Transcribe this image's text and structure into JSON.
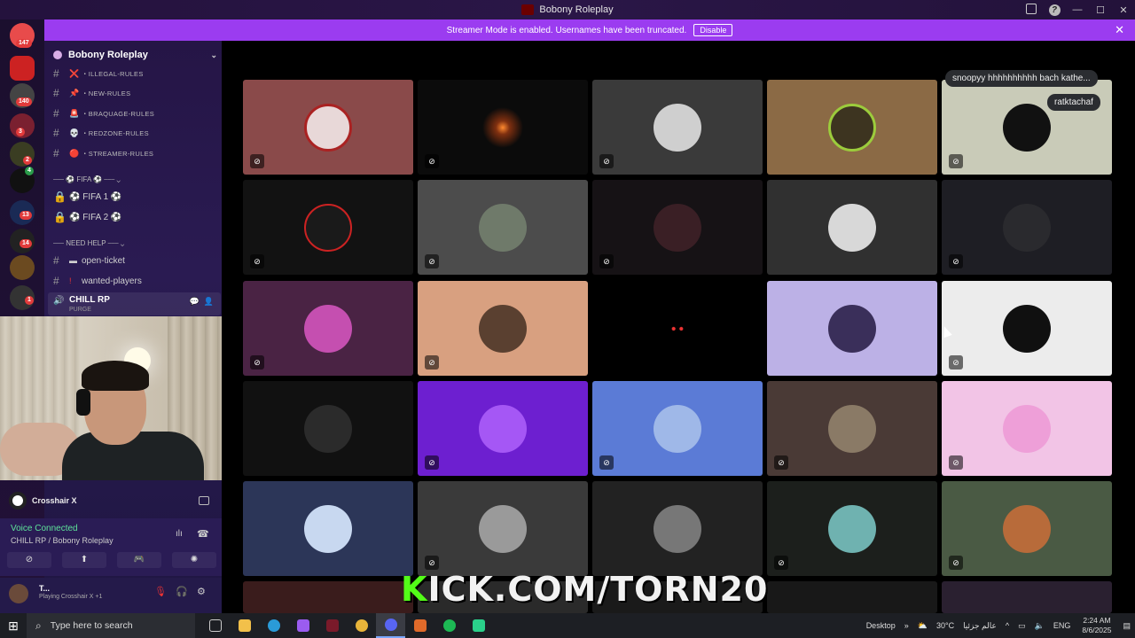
{
  "window": {
    "title": "Bobony Roleplay"
  },
  "banner": {
    "text": "Streamer Mode is enabled. Usernames have been truncated.",
    "button": "Disable",
    "close": "✕"
  },
  "rail": {
    "badges": [
      "147",
      "140",
      "3",
      "2",
      "4",
      "13",
      "14",
      "1"
    ]
  },
  "server": {
    "name": "Bobony Roleplay",
    "channels": [
      {
        "emoji": "❌",
        "name": "・ILLEGAL-RULES"
      },
      {
        "emoji": "📌",
        "name": "・NEW-RULES"
      },
      {
        "emoji": "🚨",
        "name": "・BRAQUAGE-RULES"
      },
      {
        "emoji": "💀",
        "name": "・REDZONE-RULES"
      },
      {
        "emoji": "🔴",
        "name": "・STREAMER-RULES"
      }
    ],
    "cat_fifa": "⎯⎯⎯ ⚽ FIFA ⚽ ⎯⎯⎯",
    "fifa1": "⚽ FIFA 1 ⚽",
    "fifa2": "⚽ FIFA 2 ⚽",
    "cat_help": "⎯⎯⎯ NEED HELP ⎯⎯⎯",
    "open_ticket": "open-ticket",
    "wanted_players": "wanted-players",
    "voice_channel": "CHILL RP",
    "voice_sub": "PURGE"
  },
  "activity": {
    "name": "Crosshair X"
  },
  "voice": {
    "status": "Voice Connected",
    "location": "CHILL RP / Bobony Roleplay"
  },
  "user": {
    "name": "T...",
    "status": "Playing Crosshair X",
    "extra": "+1"
  },
  "bubbles": {
    "b1": "snoopyy hhhhhhhhhh bach kathe...",
    "b2": "ratktachaf"
  },
  "overlay": {
    "k": "K",
    "rest": "ICK.COM/TORN20"
  },
  "taskbar": {
    "search": "Type here to search",
    "desktop": "Desktop",
    "weather": "30°C",
    "weather_label": "عالم جزئيا",
    "lang": "ENG",
    "time": "2:24 AM",
    "date": "8/6/2025"
  },
  "colors": {
    "banner": "#9b3cf0",
    "voice_connected": "#5ee39a",
    "kick_green": "#53fc18"
  }
}
